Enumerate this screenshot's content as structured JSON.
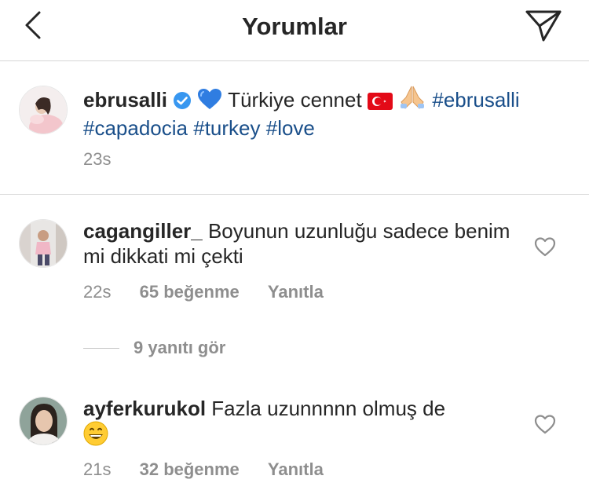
{
  "header": {
    "title": "Yorumlar"
  },
  "caption": {
    "username": "ebrusalli",
    "text_after_heart": " Türkiye cennet ",
    "hashtag1": "#ebrusalli",
    "hashtag2": "#capadocia",
    "hashtag3": "#turkey",
    "hashtag4": "#love",
    "time": "23s"
  },
  "comments": [
    {
      "username": "cagangiller_",
      "text": " Boyunun uzunluğu sadece benim mi dikkati mi çekti",
      "time": "22s",
      "likes": "65 beğenme",
      "reply": "Yanıtla"
    },
    {
      "username": "ayferkurukol",
      "text": " Fazla uzunnnnn olmuş de",
      "time": "21s",
      "likes": "32 beğenme",
      "reply": "Yanıtla"
    }
  ],
  "view_replies": "9 yanıtı gör",
  "colors": {
    "hashtag": "#1a4f8a",
    "verified": "#3897f0",
    "muted": "#8e8e8e"
  }
}
